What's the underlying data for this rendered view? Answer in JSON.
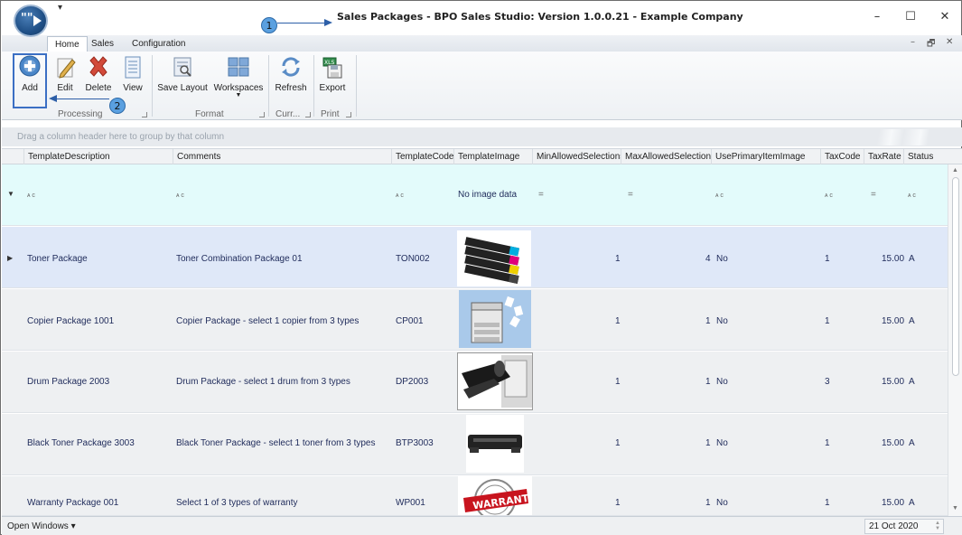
{
  "window": {
    "title": "Sales Packages - BPO Sales Studio: Version 1.0.0.21 - Example Company",
    "app_logo_text": "\"\"",
    "quick_access": "▾",
    "minimize": "–",
    "maximize": "☐",
    "close": "✕"
  },
  "annotations": {
    "badge1": "1",
    "badge2": "2"
  },
  "tabs": [
    {
      "label": "Home"
    },
    {
      "label": "Sales"
    },
    {
      "label": "Configuration"
    }
  ],
  "mdi_controls": {
    "minimize": "–",
    "restore": "🗗",
    "close": "✕"
  },
  "ribbon": {
    "buttons": {
      "add": "Add",
      "edit": "Edit",
      "delete": "Delete",
      "view": "View",
      "save_layout": "Save Layout",
      "workspaces": "Workspaces",
      "refresh": "Refresh",
      "export": "Export"
    },
    "groups": {
      "processing": "Processing",
      "format": "Format",
      "currency": "Curr...",
      "print": "Print"
    }
  },
  "grid": {
    "group_panel_text": "Drag a column header here to group by that column",
    "columns": [
      "TemplateDescription",
      "Comments",
      "TemplateCode",
      "TemplateImage",
      "MinAllowedSelections",
      "MaxAllowedSelections",
      "UsePrimaryItemImage",
      "TaxCode",
      "TaxRate",
      "Status"
    ],
    "filter_row": {
      "text_filter_label": "ᴀ c",
      "no_image": "No image data",
      "equals": "="
    },
    "rows": [
      {
        "description": "Toner Package",
        "comments": "Toner Combination Package 01",
        "code": "TON002",
        "image": "toner-cartridges",
        "min": "1",
        "max": "4",
        "use_primary": "No",
        "tax_code": "1",
        "tax_rate": "15.00",
        "status": "A"
      },
      {
        "description": "Copier Package 1001",
        "comments": "Copier Package - select 1 copier from 3 types",
        "code": "CP001",
        "image": "copier",
        "min": "1",
        "max": "1",
        "use_primary": "No",
        "tax_code": "1",
        "tax_rate": "15.00",
        "status": "A"
      },
      {
        "description": "Drum Package 2003",
        "comments": "Drum Package - select 1 drum from 3 types",
        "code": "DP2003",
        "image": "drum-unit",
        "min": "1",
        "max": "1",
        "use_primary": "No",
        "tax_code": "3",
        "tax_rate": "15.00",
        "status": "A"
      },
      {
        "description": "Black Toner Package 3003",
        "comments": "Black Toner Package - select 1 toner from 3 types",
        "code": "BTP3003",
        "image": "black-toner",
        "min": "1",
        "max": "1",
        "use_primary": "No",
        "tax_code": "1",
        "tax_rate": "15.00",
        "status": "A"
      },
      {
        "description": "Warranty Package 001",
        "comments": "Select 1 of 3 types of warranty",
        "code": "WP001",
        "image": "warranty-stamp",
        "min": "1",
        "max": "1",
        "use_primary": "No",
        "tax_code": "1",
        "tax_rate": "15.00",
        "status": "A"
      }
    ]
  },
  "statusbar": {
    "open_windows": "Open Windows ▾",
    "date": "21 Oct 2020"
  }
}
